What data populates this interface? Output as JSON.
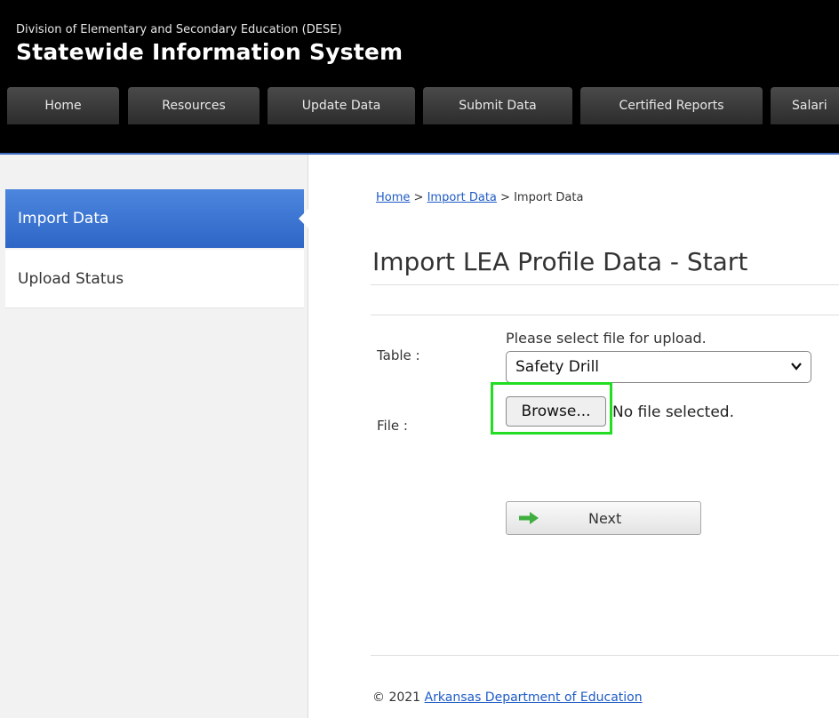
{
  "header": {
    "subtitle": "Division of Elementary and Secondary Education (DESE)",
    "title": "Statewide Information System"
  },
  "tabs": [
    {
      "label": "Home"
    },
    {
      "label": "Resources"
    },
    {
      "label": "Update Data"
    },
    {
      "label": "Submit Data"
    },
    {
      "label": "Certified Reports"
    },
    {
      "label": "Salari"
    }
  ],
  "sidebar": {
    "items": [
      {
        "label": "Import Data",
        "active": true
      },
      {
        "label": "Upload Status",
        "active": false
      }
    ]
  },
  "breadcrumb": {
    "home": "Home",
    "sep": ">",
    "import_link": "Import Data",
    "current": "Import Data"
  },
  "main": {
    "page_title": "Import LEA Profile Data - Start",
    "prompt": "Please select file for upload.",
    "table_label": "Table :",
    "file_label": "File :",
    "table_select_value": "Safety Drill",
    "browse_label": "Browse...",
    "no_file_text": "No file selected.",
    "next_label": "Next"
  },
  "footer": {
    "copyright": "© 2021",
    "org_link": "Arkansas Department of Education"
  },
  "colors": {
    "header_bg": "#000000",
    "accent_blue": "#2d66c6",
    "link_blue": "#1e5bc6",
    "highlight_green": "#22dd22",
    "arrow_green": "#3fae3f"
  }
}
